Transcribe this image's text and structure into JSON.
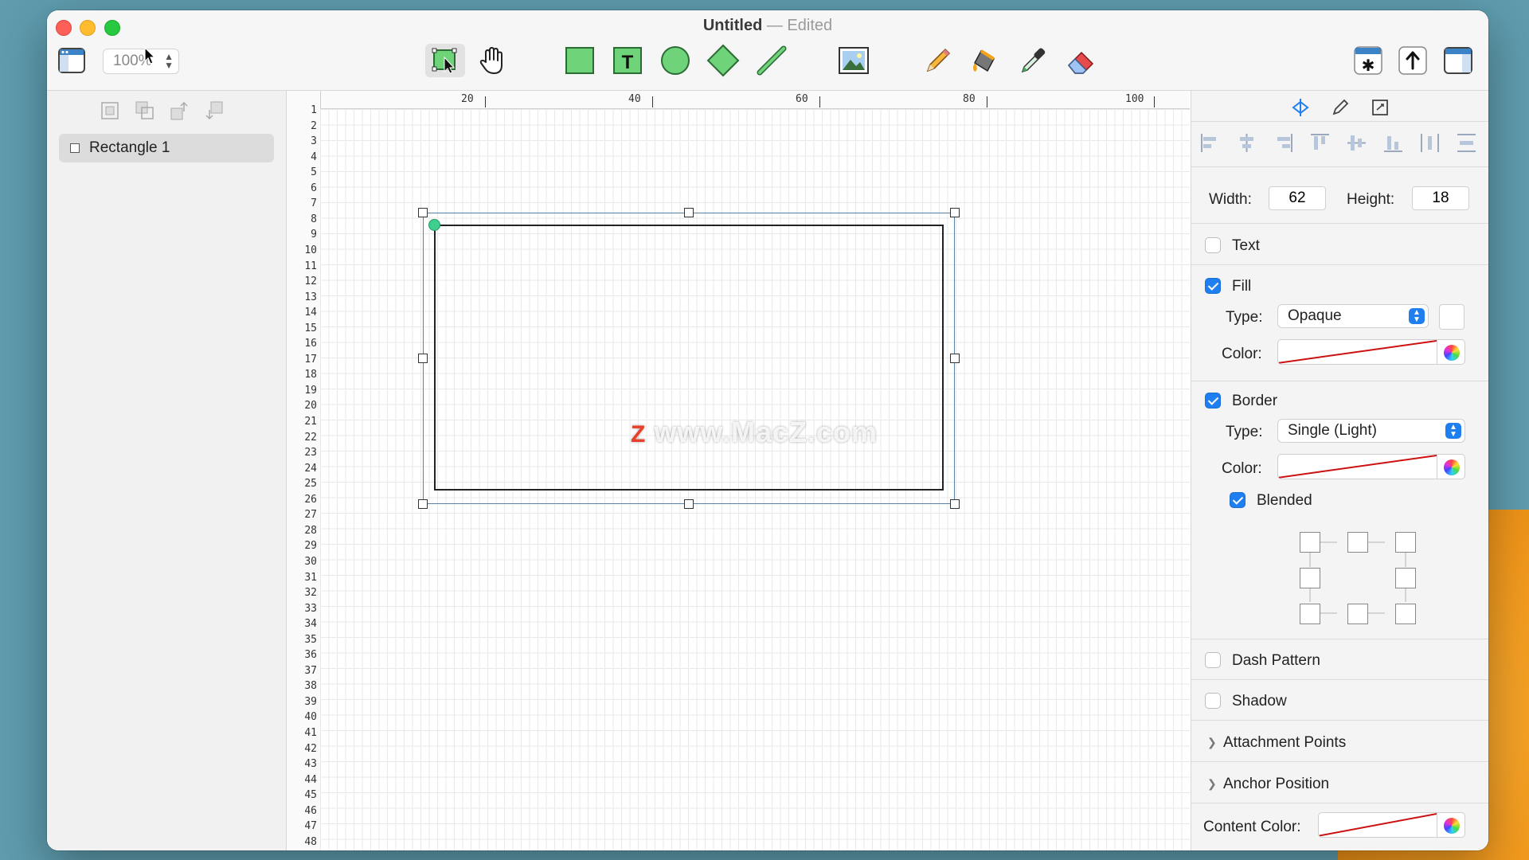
{
  "window": {
    "title": "Untitled",
    "separator": "—",
    "status": "Edited"
  },
  "toolbar": {
    "zoom": "100%",
    "tools": [
      "select-tool",
      "pan-tool",
      "rectangle-tool",
      "text-tool",
      "ellipse-tool",
      "diamond-tool",
      "line-tool",
      "image-tool",
      "pencil-tool",
      "paint-bucket-tool",
      "eyedropper-tool",
      "eraser-tool"
    ],
    "text_tool_glyph": "T",
    "right_buttons": [
      "symbol-button",
      "share-button",
      "inspector-toggle-button"
    ]
  },
  "sidebar": {
    "layers": [
      {
        "label": "Rectangle 1"
      }
    ]
  },
  "ruler": {
    "h_ticks": [
      "20",
      "40",
      "60",
      "80",
      "100"
    ],
    "v_ticks": [
      "1",
      "2",
      "3",
      "4",
      "5",
      "6",
      "7",
      "8",
      "9",
      "10",
      "11",
      "12",
      "13",
      "14",
      "15",
      "16",
      "17",
      "18",
      "19",
      "20",
      "21",
      "22",
      "23",
      "24",
      "25",
      "26",
      "27",
      "28",
      "29",
      "30",
      "31",
      "32",
      "33",
      "34",
      "35",
      "36",
      "37",
      "38",
      "39",
      "40",
      "41",
      "42",
      "43",
      "44",
      "45",
      "46",
      "47",
      "48"
    ]
  },
  "canvas": {
    "watermark_mark": "Z",
    "watermark_text": "www.MacZ.com"
  },
  "inspector": {
    "width_label": "Width:",
    "width_value": "62",
    "height_label": "Height:",
    "height_value": "18",
    "text": {
      "label": "Text",
      "checked": false
    },
    "fill": {
      "label": "Fill",
      "checked": true,
      "type_label": "Type:",
      "type_value": "Opaque",
      "color_label": "Color:"
    },
    "border": {
      "label": "Border",
      "checked": true,
      "type_label": "Type:",
      "type_value": "Single (Light)",
      "color_label": "Color:",
      "blended_label": "Blended",
      "blended_checked": true
    },
    "dash_pattern": {
      "label": "Dash Pattern",
      "checked": false
    },
    "shadow": {
      "label": "Shadow",
      "checked": false
    },
    "attachment_points": "Attachment Points",
    "anchor_position": "Anchor Position",
    "content_color_label": "Content Color:",
    "empty_color": "#cc1111"
  }
}
